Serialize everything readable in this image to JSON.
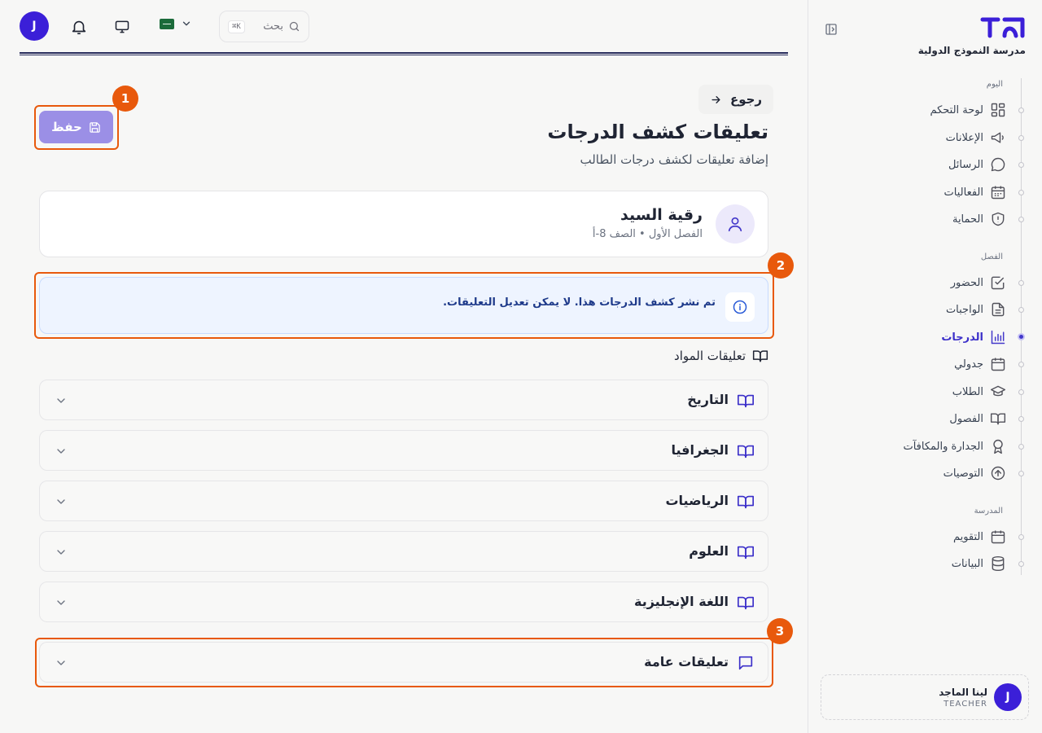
{
  "app": {
    "school_name": "مدرسة النموذج الدولية"
  },
  "topbar": {
    "search_placeholder": "بحث",
    "search_shortcut": "K⌘",
    "user_initial": "J"
  },
  "sidebar": {
    "sections": [
      {
        "label": "اليوم",
        "items": [
          {
            "label": "لوحة التحكم",
            "icon": "dashboard-grid-icon"
          },
          {
            "label": "الإعلانات",
            "icon": "megaphone-icon"
          },
          {
            "label": "الرسائل",
            "icon": "chat-bubble-icon"
          },
          {
            "label": "الفعاليات",
            "icon": "calendar-grid-icon"
          },
          {
            "label": "الحماية",
            "icon": "shield-alert-icon"
          }
        ]
      },
      {
        "label": "الفصل",
        "items": [
          {
            "label": "الحضور",
            "icon": "check-square-icon"
          },
          {
            "label": "الواجبات",
            "icon": "document-icon"
          },
          {
            "label": "الدرجات",
            "icon": "bar-chart-icon",
            "active": true
          },
          {
            "label": "جدولي",
            "icon": "calendar-icon"
          },
          {
            "label": "الطلاب",
            "icon": "graduation-cap-icon"
          },
          {
            "label": "الفصول",
            "icon": "open-book-icon"
          },
          {
            "label": "الجدارة والمكافآت",
            "icon": "award-ribbon-icon"
          },
          {
            "label": "التوصيات",
            "icon": "arrow-up-circle-icon"
          }
        ]
      },
      {
        "label": "المدرسة",
        "items": [
          {
            "label": "التقويم",
            "icon": "calendar-icon"
          },
          {
            "label": "البيانات",
            "icon": "database-icon"
          }
        ]
      }
    ],
    "user": {
      "name": "لينا الماجد",
      "role": "TEACHER",
      "initial": "J"
    }
  },
  "header": {
    "back_label": "رجوع",
    "title": "تعليقات كشف الدرجات",
    "subtitle": "إضافة تعليقات لكشف درجات الطالب",
    "save_label": "حفظ"
  },
  "student": {
    "name": "رقية السيد",
    "meta": "الفصل الأول • الصف 8-أ"
  },
  "alert": {
    "text": "تم نشر كشف الدرجات هذا. لا يمكن تعديل التعليقات."
  },
  "subjects": {
    "heading": "تعليقات المواد",
    "items": [
      {
        "label": "التاريخ"
      },
      {
        "label": "الجغرافيا"
      },
      {
        "label": "الرياضيات"
      },
      {
        "label": "العلوم"
      },
      {
        "label": "اللغة الإنجليزية"
      }
    ]
  },
  "general": {
    "label": "تعليقات عامة"
  },
  "annotations": {
    "badges": [
      "1",
      "2",
      "3"
    ],
    "color": "#e8590c"
  },
  "colors": {
    "accent": "#4338ca",
    "save_button": "#9b8fe6",
    "info_bg": "#eef4ff",
    "info_text": "#1e3a8a"
  }
}
